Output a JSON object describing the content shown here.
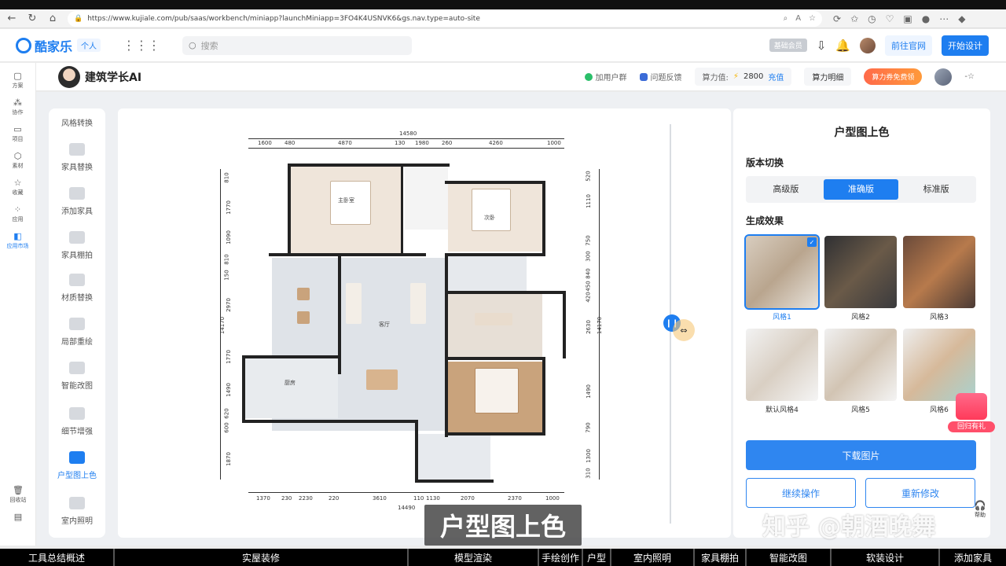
{
  "browser": {
    "url": "https://www.kujiale.com/pub/saas/workbench/miniapp?launchMiniapp=3FO4K4USNVK6&gs.nav.type=auto-site"
  },
  "header": {
    "logo": "酷家乐",
    "user_chip": "个人",
    "search_placeholder": "搜索",
    "member_badge": "基础会员",
    "site_button": "前往官网",
    "design_button": "开始设计"
  },
  "rail": {
    "items": [
      "方案",
      "协作",
      "项目",
      "素材",
      "收藏",
      "应用",
      "应用市场"
    ],
    "bottom": "回收站"
  },
  "ai_bar": {
    "title": "建筑学长AI",
    "add_group": "加用户群",
    "feedback": "问题反馈",
    "power_label": "算力值:",
    "power_value": "2800",
    "recharge": "充值",
    "power_detail": "算力明细",
    "coupon": "算力券免费领",
    "star": "-☆"
  },
  "tools": [
    "风格转换",
    "家具替换",
    "添加家具",
    "家具棚拍",
    "材质替换",
    "局部重绘",
    "智能改图",
    "细节增强",
    "户型图上色",
    "室内照明"
  ],
  "tool_active": "户型图上色",
  "plan": {
    "top_total": "14580",
    "top_dims": [
      "1600",
      "480",
      "4870",
      "130",
      "1980",
      "260",
      "4260",
      "1000"
    ],
    "bottom_total": "14490",
    "bottom_dims": [
      "1370",
      "230",
      "2230",
      "220",
      "3610",
      "110",
      "1130",
      "2070",
      "2370",
      "1000"
    ],
    "left_total": "14170",
    "left_dims": [
      "810",
      "1770",
      "1090",
      "810",
      "150",
      "2970",
      "1770",
      "1490",
      "620",
      "600",
      "1870"
    ],
    "right_total": "14170",
    "right_dims": [
      "520",
      "1110",
      "750",
      "300",
      "840",
      "450",
      "420",
      "2630",
      "1490",
      "790",
      "1300",
      "310"
    ],
    "rooms": [
      "主卧室",
      "次卧",
      "客厅",
      "厨房"
    ]
  },
  "right_panel": {
    "title": "户型图上色",
    "version_label": "版本切换",
    "versions": [
      "高级版",
      "准确版",
      "标准版"
    ],
    "active_version": "准确版",
    "effect_label": "生成效果",
    "styles": [
      "风格1",
      "风格2",
      "风格3",
      "默认风格4",
      "风格5",
      "风格6"
    ],
    "download": "下载图片",
    "continue": "继续操作",
    "modify": "重新修改",
    "gift": "回归有礼",
    "help": "帮助"
  },
  "overlay": {
    "caption": "户型图上色",
    "watermark": "知乎 @朝酒晚舞"
  },
  "bottom_bar": [
    "工具总结概述",
    "实屋装修",
    "模型渲染",
    "手绘创作",
    "户型",
    "室内照明",
    "家具棚拍",
    "智能改图",
    "软装设计",
    "添加家具"
  ],
  "colors": {
    "accent": "#1e7ef0",
    "wood": "#c9a37c",
    "floor_gray": "#dfe3e8"
  }
}
